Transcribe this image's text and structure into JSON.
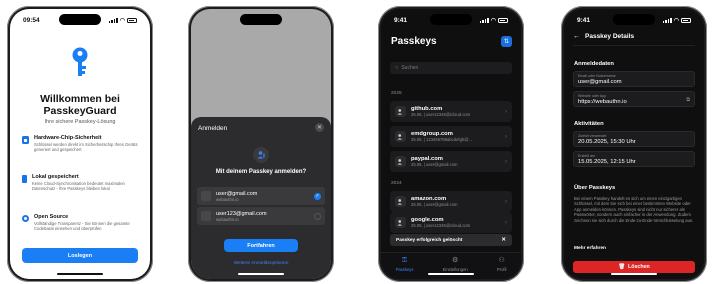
{
  "phone1": {
    "time": "09:54",
    "title": "Willkommen bei PasskeyGuard",
    "subtitle": "Ihre sichere Passkey-Lösung",
    "features": [
      {
        "icon": "chip-icon",
        "title": "Hardware-Chip-Sicherheit",
        "text": "Schlüssel werden direkt im Sicherheitschip Ihres Geräts generiert und gespeichert"
      },
      {
        "icon": "phone-icon",
        "title": "Lokal gespeichert",
        "text": "Keine Cloud-Synchronisation bedeutet maximalen Datenschutz - Ihre Passkeys bleiben lokal"
      },
      {
        "icon": "open-source-icon",
        "title": "Open Source",
        "text": "Vollständige Transparenz - Sie können die gesamte Codebasis einsehen und überprüfen"
      }
    ],
    "cta": "Loslegen"
  },
  "phone2": {
    "sheet_title": "Anmelden",
    "question": "Mit deinem Passkey anmelden?",
    "accounts": [
      {
        "email": "user@gmail.com",
        "domain": "webauthn.io",
        "selected": true
      },
      {
        "email": "user123@gmail.com",
        "domain": "webauthn.io",
        "selected": false
      }
    ],
    "continue": "Fortfahren",
    "more_options": "Weitere Anmeldeoptionen"
  },
  "phone3": {
    "time": "9:41",
    "title": "Passkeys",
    "search_placeholder": "Suchen",
    "groups": [
      {
        "year": "2025",
        "items": [
          {
            "name": "github.com",
            "sub": "25.05. | user12345@icloud.com"
          },
          {
            "name": "emdgroup.com",
            "sub": "25.05. | 123456789abcdefgh@..."
          },
          {
            "name": "paypal.com",
            "sub": "25.05. | user@gmail.com"
          }
        ]
      },
      {
        "year": "2024",
        "items": [
          {
            "name": "amazon.com",
            "sub": "25.05. | user@gmail.com"
          },
          {
            "name": "google.com",
            "sub": "25.05. | user12345@icloud.com"
          }
        ]
      }
    ],
    "toast": "Passkey erfolgreich gelöscht",
    "tabs": [
      "Passkeys",
      "Einstellungen",
      "Profil"
    ]
  },
  "phone4": {
    "time": "9:41",
    "nav_title": "Passkey Details",
    "login_section": "Anmeldedaten",
    "email_label": "Email oder Nutzername",
    "email_value": "user@gmail.com",
    "site_label": "Website oder App",
    "site_value": "https://webauthn.io",
    "activity_section": "Aktivitäten",
    "last_used_label": "Zuletzt verwendet",
    "last_used_value": "20.05.2025, 15:30 Uhr",
    "created_label": "Erstellt am",
    "created_value": "15.05.2025, 12:15 Uhr",
    "about_section": "Über Passkeys",
    "about_text": "Bei einem Passkey handelt es sich um einen einzigartigen Schlüssel, mit dem Sie sich bei einer bestimmten Website oder App anmelden können. Passkeys sind nicht nur sicherer als Passwörter, sondern auch einfacher in der Anwendung. Zudem zeichnen sie sich durch die Ende-zu-Ende-Verschlüsselung aus.",
    "learn_more": "Mehr erfahren",
    "delete": "Löschen"
  },
  "colors": {
    "accent": "#1a7ef5",
    "danger": "#dc2626",
    "dark_bg": "#0f0f10",
    "card": "#1c1c1e"
  }
}
